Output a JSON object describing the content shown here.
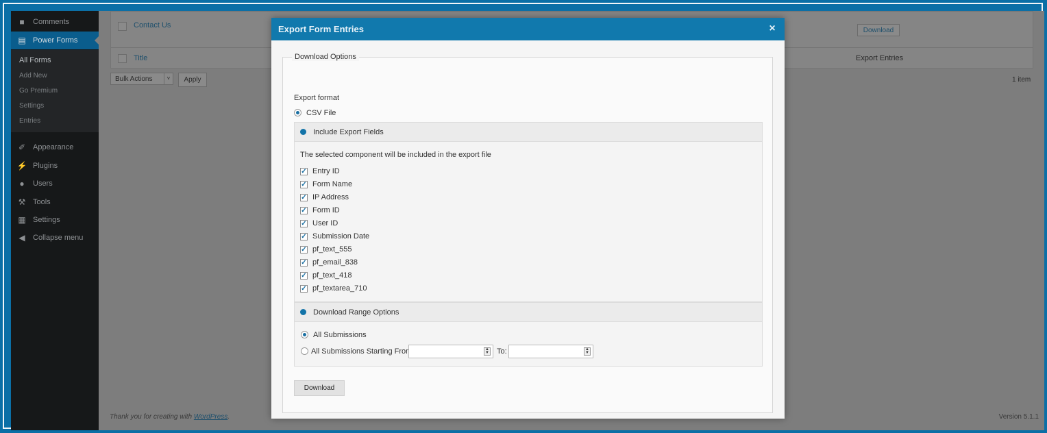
{
  "sidebar": {
    "comments": "Comments",
    "power_forms": "Power Forms",
    "sub": [
      "All Forms",
      "Add New",
      "Go Premium",
      "Settings",
      "Entries"
    ],
    "appearance": "Appearance",
    "plugins": "Plugins",
    "users": "Users",
    "tools": "Tools",
    "settings": "Settings",
    "collapse": "Collapse menu"
  },
  "table": {
    "row_title": "Contact Us",
    "row_download": "Download",
    "col_title": "Title",
    "col_export": "Export Entries",
    "bulk_actions": "Bulk Actions",
    "apply": "Apply",
    "count": "1 item"
  },
  "footer": {
    "thanks_prefix": "Thank you for creating with ",
    "thanks_link": "WordPress",
    "thanks_suffix": ".",
    "version": "Version 5.1.1"
  },
  "modal": {
    "title": "Export Form Entries",
    "close": "×",
    "legend": "Download Options",
    "export_format_label": "Export format",
    "csv_label": "CSV File",
    "include_section": {
      "title": "Include Export Fields",
      "description": "The selected component will be included in the export file",
      "fields": [
        "Entry ID",
        "Form Name",
        "IP Address",
        "Form ID",
        "User ID",
        "Submission Date",
        "pf_text_555",
        "pf_email_838",
        "pf_text_418",
        "pf_textarea_710"
      ]
    },
    "range_section": {
      "title": "Download Range Options",
      "all_label": "All Submissions",
      "from_label": "All Submissions Starting From:",
      "to_label": "To:",
      "from_value": "",
      "to_value": ""
    },
    "download_button": "Download"
  },
  "colors": {
    "frame": "#0b6fa6",
    "modal_header": "#1179ad",
    "accent": "#1273a8"
  }
}
